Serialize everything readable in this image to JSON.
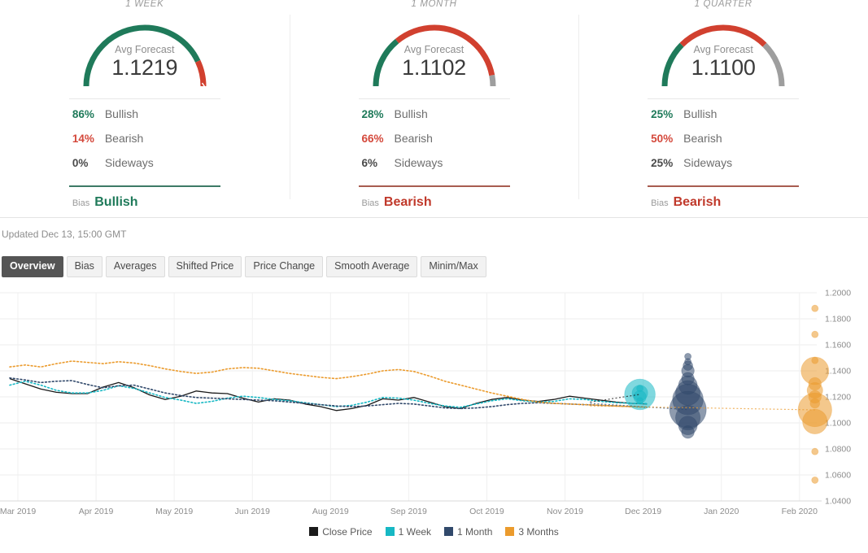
{
  "panels": [
    {
      "title": "1 WEEK",
      "gauge_label": "Avg Forecast",
      "gauge_value": "1.1219",
      "gauge": {
        "bullish": 86,
        "bearish": 14,
        "sideways": 0
      },
      "stats": [
        {
          "pct": "86%",
          "name": "Bullish",
          "kind": "bullish"
        },
        {
          "pct": "14%",
          "name": "Bearish",
          "kind": "bearish"
        },
        {
          "pct": "0%",
          "name": "Sideways",
          "kind": "sideways"
        }
      ],
      "bias_label": "Bias",
      "bias_value": "Bullish",
      "bias_kind": "bull"
    },
    {
      "title": "1 MONTH",
      "gauge_label": "Avg Forecast",
      "gauge_value": "1.1102",
      "gauge": {
        "bullish": 28,
        "bearish": 66,
        "sideways": 6
      },
      "stats": [
        {
          "pct": "28%",
          "name": "Bullish",
          "kind": "bullish"
        },
        {
          "pct": "66%",
          "name": "Bearish",
          "kind": "bearish"
        },
        {
          "pct": "6%",
          "name": "Sideways",
          "kind": "sideways"
        }
      ],
      "bias_label": "Bias",
      "bias_value": "Bearish",
      "bias_kind": "bear"
    },
    {
      "title": "1 QUARTER",
      "gauge_label": "Avg Forecast",
      "gauge_value": "1.1100",
      "gauge": {
        "bullish": 25,
        "bearish": 50,
        "sideways": 25
      },
      "stats": [
        {
          "pct": "25%",
          "name": "Bullish",
          "kind": "bullish"
        },
        {
          "pct": "50%",
          "name": "Bearish",
          "kind": "bearish"
        },
        {
          "pct": "25%",
          "name": "Sideways",
          "kind": "sideways"
        }
      ],
      "bias_label": "Bias",
      "bias_value": "Bearish",
      "bias_kind": "bear"
    }
  ],
  "updated": "Updated Dec 13, 15:00 GMT",
  "tabs": [
    {
      "label": "Overview",
      "active": true
    },
    {
      "label": "Bias",
      "active": false
    },
    {
      "label": "Averages",
      "active": false
    },
    {
      "label": "Shifted Price",
      "active": false
    },
    {
      "label": "Price Change",
      "active": false
    },
    {
      "label": "Smooth Average",
      "active": false
    },
    {
      "label": "Minim/Max",
      "active": false
    }
  ],
  "colors": {
    "bullish": "#1f7a5a",
    "bearish": "#d4483b",
    "sideways": "#9e9e9e",
    "close_price": "#1a1a1a",
    "one_week": "#17b8c4",
    "one_month": "#31496b",
    "three_months": "#eb9b2d"
  },
  "chart_data": {
    "type": "line",
    "title": "",
    "xlabel": "",
    "ylabel": "",
    "ylim": [
      1.04,
      1.2
    ],
    "ytick_step": 0.02,
    "ytick_labels": [
      "1.2000",
      "1.1800",
      "1.1600",
      "1.1400",
      "1.1200",
      "1.1000",
      "1.0800",
      "1.0600",
      "1.0400"
    ],
    "xtick_labels": [
      "Mar 2019",
      "Apr 2019",
      "May 2019",
      "Jun 2019",
      "Aug 2019",
      "Sep 2019",
      "Oct 2019",
      "Nov 2019",
      "Dec 2019",
      "Jan 2020",
      "Feb 2020"
    ],
    "grid": true,
    "legend_position": "bottom",
    "legend": [
      "Close Price",
      "1 Week",
      "1 Month",
      "3 Months"
    ],
    "series": [
      {
        "name": "Close Price",
        "color": "#1a1a1a",
        "style": "solid",
        "values": [
          1.134,
          1.13,
          1.126,
          1.1235,
          1.1225,
          1.1225,
          1.1275,
          1.131,
          1.127,
          1.1215,
          1.118,
          1.1205,
          1.1245,
          1.123,
          1.1225,
          1.119,
          1.116,
          1.1185,
          1.1175,
          1.1145,
          1.1125,
          1.1095,
          1.111,
          1.1135,
          1.1185,
          1.1175,
          1.1195,
          1.116,
          1.1125,
          1.111,
          1.115,
          1.118,
          1.1195,
          1.1175,
          1.1165,
          1.118,
          1.1205,
          1.119,
          1.1175,
          1.116,
          1.115,
          1.1145
        ]
      },
      {
        "name": "1 Week",
        "color": "#17b8c4",
        "style": "dotted",
        "values": [
          1.129,
          1.132,
          1.129,
          1.125,
          1.123,
          1.123,
          1.125,
          1.1285,
          1.1265,
          1.123,
          1.1195,
          1.1175,
          1.115,
          1.1165,
          1.119,
          1.1205,
          1.1195,
          1.118,
          1.117,
          1.1155,
          1.114,
          1.1125,
          1.1135,
          1.116,
          1.1195,
          1.119,
          1.1175,
          1.115,
          1.113,
          1.112,
          1.1145,
          1.117,
          1.1185,
          1.117,
          1.116,
          1.1165,
          1.1185,
          1.118,
          1.1165,
          1.1155,
          1.115,
          1.1148
        ],
        "forecast_bubbles": {
          "x_label": "Dec 2019",
          "center": 1.1219,
          "points": [
            {
              "value": 1.1265,
              "weight": 1
            },
            {
              "value": 1.123,
              "weight": 4
            },
            {
              "value": 1.1219,
              "weight": 9
            },
            {
              "value": 1.12,
              "weight": 3
            },
            {
              "value": 1.117,
              "weight": 1
            }
          ]
        }
      },
      {
        "name": "1 Month",
        "color": "#31496b",
        "style": "dotted",
        "values": [
          1.1345,
          1.133,
          1.131,
          1.132,
          1.1325,
          1.1295,
          1.127,
          1.1285,
          1.129,
          1.126,
          1.123,
          1.121,
          1.1195,
          1.119,
          1.1185,
          1.118,
          1.1175,
          1.117,
          1.116,
          1.115,
          1.114,
          1.113,
          1.1125,
          1.113,
          1.114,
          1.115,
          1.1145,
          1.113,
          1.1115,
          1.111,
          1.1115,
          1.1125,
          1.114,
          1.115,
          1.1155,
          1.115,
          1.1145,
          1.114,
          1.1135,
          1.113,
          1.1125,
          1.112
        ],
        "forecast_bubbles": {
          "x_label": "Dec 2019",
          "center": 1.1102,
          "points": [
            {
              "value": 1.151,
              "weight": 1
            },
            {
              "value": 1.147,
              "weight": 1
            },
            {
              "value": 1.144,
              "weight": 2
            },
            {
              "value": 1.14,
              "weight": 3
            },
            {
              "value": 1.134,
              "weight": 3
            },
            {
              "value": 1.129,
              "weight": 5
            },
            {
              "value": 1.123,
              "weight": 7
            },
            {
              "value": 1.118,
              "weight": 9
            },
            {
              "value": 1.1102,
              "weight": 11
            },
            {
              "value": 1.104,
              "weight": 7
            },
            {
              "value": 1.098,
              "weight": 5
            },
            {
              "value": 1.093,
              "weight": 3
            }
          ]
        }
      },
      {
        "name": "3 Months",
        "color": "#eb9b2d",
        "style": "dotted",
        "values": [
          1.143,
          1.1445,
          1.143,
          1.1455,
          1.1475,
          1.1465,
          1.1455,
          1.147,
          1.146,
          1.144,
          1.1415,
          1.1395,
          1.138,
          1.139,
          1.1415,
          1.1425,
          1.142,
          1.14,
          1.138,
          1.1365,
          1.135,
          1.134,
          1.1355,
          1.1375,
          1.14,
          1.141,
          1.1395,
          1.136,
          1.132,
          1.129,
          1.126,
          1.123,
          1.1205,
          1.118,
          1.116,
          1.115,
          1.1145,
          1.114,
          1.1135,
          1.113,
          1.1125,
          1.112
        ],
        "forecast_bubbles": {
          "x_label": "Feb 2020",
          "center": 1.11,
          "points": [
            {
              "value": 1.188,
              "weight": 1
            },
            {
              "value": 1.168,
              "weight": 1
            },
            {
              "value": 1.148,
              "weight": 1
            },
            {
              "value": 1.14,
              "weight": 8
            },
            {
              "value": 1.13,
              "weight": 3
            },
            {
              "value": 1.125,
              "weight": 4
            },
            {
              "value": 1.12,
              "weight": 3
            },
            {
              "value": 1.115,
              "weight": 2
            },
            {
              "value": 1.11,
              "weight": 10
            },
            {
              "value": 1.101,
              "weight": 7
            },
            {
              "value": 1.078,
              "weight": 1
            },
            {
              "value": 1.056,
              "weight": 1
            }
          ]
        }
      }
    ]
  }
}
